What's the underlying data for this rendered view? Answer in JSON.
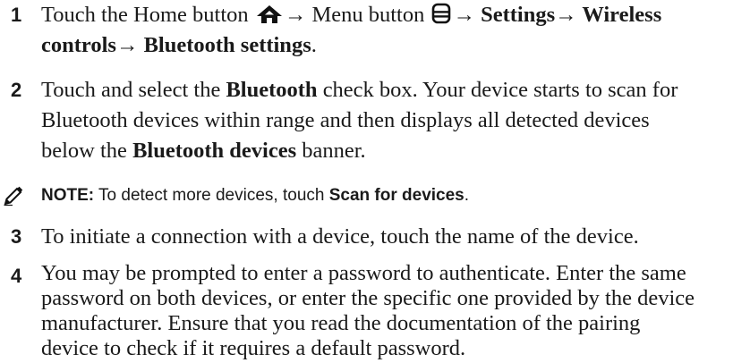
{
  "steps": [
    {
      "number": "1",
      "part1": "Touch the Home button",
      "arrow1": "→",
      "part2": " Menu button",
      "arrow2": "→",
      "settings": " Settings",
      "arrow3": "→",
      "wireless": " Wireless",
      "line2_bold": "controls",
      "arrow4": "→",
      "bluetooth_settings": " Bluetooth settings",
      "line2_end": "."
    },
    {
      "number": "2",
      "l1a": "Touch and select the ",
      "l1b": "Bluetooth",
      "l1c": " check box. Your device starts to scan for",
      "l2": "Bluetooth devices within range and then displays all detected devices",
      "l3a": "below the ",
      "l3b": "Bluetooth devices",
      "l3c": " banner."
    },
    {
      "number": "3",
      "text": "To initiate a connection with a device, touch the name of the device."
    },
    {
      "number": "4",
      "lines": [
        "You may be prompted to enter a password to authenticate. Enter the same",
        "password on both devices, or enter the specific one provided by the device",
        "manufacturer. Ensure that you read the documentation of the pairing",
        "device to check if it requires a default password."
      ]
    }
  ],
  "note": {
    "label": "NOTE:",
    "text": " To detect more devices, touch ",
    "action": "Scan for devices",
    "end": "."
  },
  "icons": [
    "home-icon",
    "menu-icon",
    "note-pen-icon"
  ]
}
